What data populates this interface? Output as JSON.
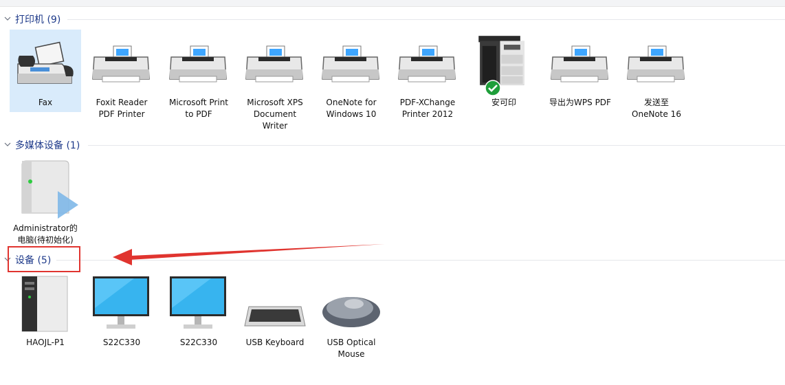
{
  "sections": [
    {
      "title": "打印机 (9)",
      "items": [
        {
          "label": "Fax",
          "icon": "fax-icon",
          "selected": true
        },
        {
          "label": "Foxit Reader\nPDF Printer",
          "icon": "printer-icon"
        },
        {
          "label": "Microsoft Print\nto PDF",
          "icon": "printer-icon"
        },
        {
          "label": "Microsoft XPS\nDocument\nWriter",
          "icon": "printer-icon"
        },
        {
          "label": "OneNote for\nWindows 10",
          "icon": "printer-icon"
        },
        {
          "label": "PDF-XChange\nPrinter 2012",
          "icon": "printer-icon"
        },
        {
          "label": "安可印",
          "icon": "copier-icon",
          "default": true
        },
        {
          "label": "导出为WPS PDF",
          "icon": "printer-icon"
        },
        {
          "label": "发送至\nOneNote 16",
          "icon": "printer-icon"
        }
      ]
    },
    {
      "title": "多媒体设备 (1)",
      "items": [
        {
          "label": "Administrator的\n电脑(待初始化)",
          "icon": "media-server-icon"
        }
      ]
    },
    {
      "title": "设备 (5)",
      "items": [
        {
          "label": "HAOJL-P1",
          "icon": "computer-tower-icon"
        },
        {
          "label": "S22C330",
          "icon": "monitor-icon"
        },
        {
          "label": "S22C330",
          "icon": "monitor-icon"
        },
        {
          "label": "USB Keyboard",
          "icon": "keyboard-icon"
        },
        {
          "label": "USB Optical\nMouse",
          "icon": "mouse-icon"
        }
      ]
    }
  ],
  "colors": {
    "header_text": "#1e3a8a",
    "selection": "#d9ebfb",
    "annotation": "#e0342f"
  }
}
